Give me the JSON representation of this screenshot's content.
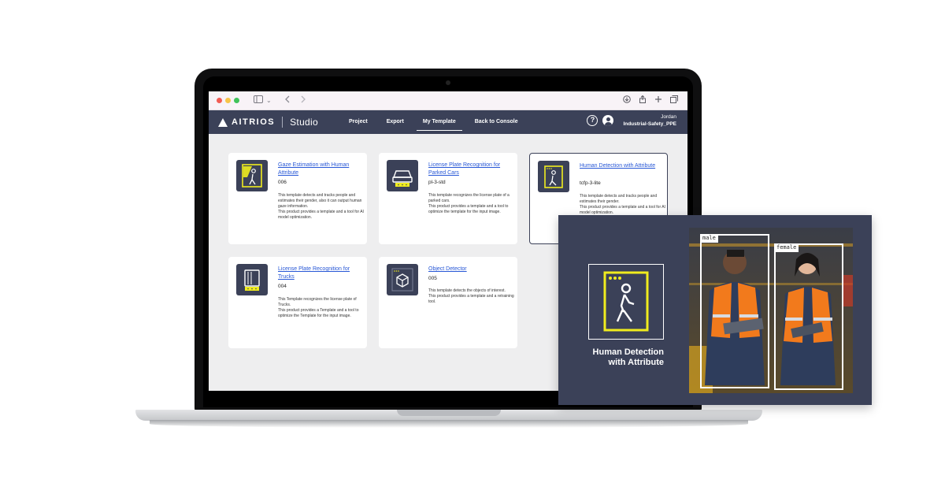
{
  "browser": {
    "traffic_lights": [
      "close",
      "minimize",
      "zoom"
    ],
    "icons": [
      "sidebar-icon",
      "chevron-down-icon",
      "back-icon",
      "forward-icon",
      "download-icon",
      "share-icon",
      "new-tab-icon",
      "tabs-icon"
    ]
  },
  "app": {
    "brand": "AITRIOS",
    "product": "Studio",
    "nav": [
      {
        "label": "Project",
        "active": false
      },
      {
        "label": "Export",
        "active": false
      },
      {
        "label": "My Template",
        "active": true
      },
      {
        "label": "Back to Console",
        "active": false
      }
    ],
    "user": {
      "name": "Jordan",
      "project": "Industrial-Safety_PPE"
    },
    "help_label": "?"
  },
  "templates": [
    {
      "title": "Gaze Estimation with Human Attribute",
      "code": "006",
      "description": "This template detects and tracks people and estimates their gender, also it can output human gaze information.\nThis product provides a template and a tool for AI model optimization.",
      "icon": "person-gaze-icon",
      "selected": false
    },
    {
      "title": "License Plate Recognition for Parked Cars",
      "code": "pl-3-std",
      "description": "This template recognizes the license plate of a parked cars.\nThis product provides a template and a tool to optimize the template for the input image.",
      "icon": "car-icon",
      "selected": false
    },
    {
      "title": "Human Detection with Attribute",
      "code": "tcfp-3-lite",
      "description": "This template detects and tracks people and estimates their gender.\nThis product provides a template and a tool for AI model optimization.",
      "icon": "person-walking-icon",
      "selected": true
    },
    {
      "title": "License Plate Recognition for Trucks",
      "code": "004",
      "description": "This Template recognizes the license plate of Trucks.\nThis product provides a Template and a tool to optimize the Template for the input image.",
      "icon": "truck-icon",
      "selected": false
    },
    {
      "title": "Object Detector",
      "code": "005",
      "description": "This template detects the objects of interest.\nThis product provides a template and a retraining tool.",
      "icon": "cube-icon",
      "selected": false
    }
  ],
  "overlay": {
    "title": "Human Detection with Attribute",
    "detections": [
      {
        "label": "male"
      },
      {
        "label": "female"
      }
    ]
  },
  "colors": {
    "nav_bg": "#3b4158",
    "accent_yellow": "#f0ec1e",
    "link_blue": "#2757d6",
    "page_bg": "#eeeeef"
  }
}
